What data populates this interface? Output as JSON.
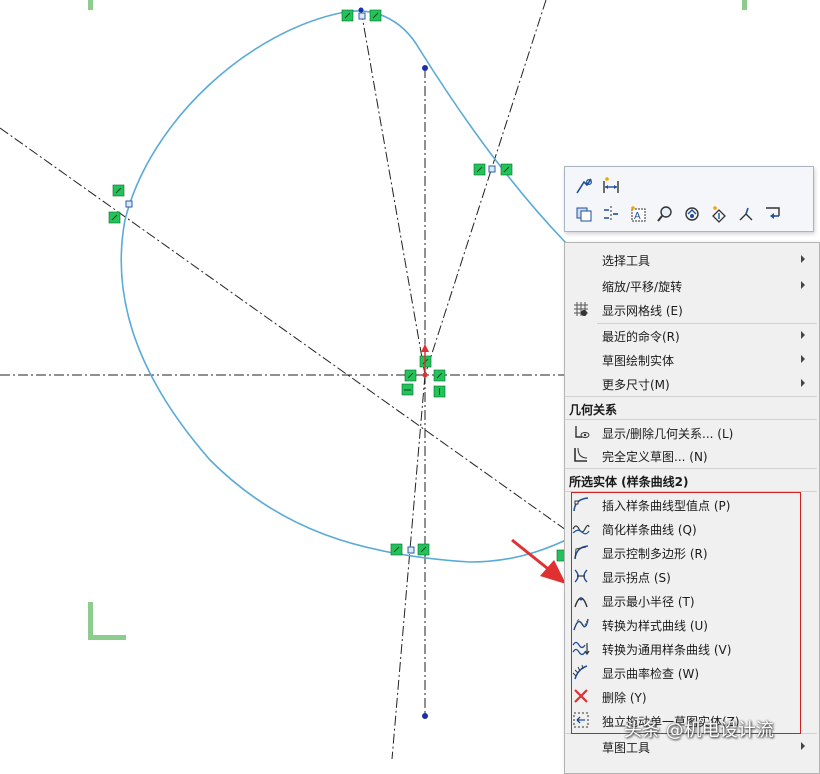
{
  "toolbar": {
    "row1": [
      "sketch-relation-icon",
      "smart-dimension-icon"
    ],
    "row2": [
      "select-other-icon",
      "mirror-icon",
      "text-icon",
      "zoom-to-selection-icon",
      "rotate-view-icon",
      "normal-to-icon",
      "sketch-face-icon",
      "exit-sketch-icon"
    ]
  },
  "menu": {
    "items": [
      {
        "label": "选择工具",
        "submenu": true,
        "icon": ""
      },
      {
        "label": "缩放/平移/旋转",
        "submenu": true,
        "icon": ""
      },
      {
        "label": "显示网格线 (E)",
        "submenu": false,
        "icon": "grid-icon"
      },
      {
        "label": "最近的命令(R)",
        "submenu": true,
        "icon": ""
      },
      {
        "label": "草图绘制实体",
        "submenu": true,
        "icon": ""
      },
      {
        "label": "更多尺寸(M)",
        "submenu": true,
        "icon": ""
      }
    ],
    "section_relations": "几何关系",
    "relation_items": [
      {
        "label": "显示/删除几何关系... (L)",
        "icon": "show-relations-icon"
      },
      {
        "label": "完全定义草图... (N)",
        "icon": "fully-define-icon"
      }
    ],
    "section_selected": "所选实体 (样条曲线2)",
    "spline_items": [
      {
        "label": "插入样条曲线型值点 (P)",
        "icon": "insert-spline-point-icon"
      },
      {
        "label": "简化样条曲线 (Q)",
        "icon": "simplify-spline-icon"
      },
      {
        "label": "显示控制多边形 (R)",
        "icon": "control-polygon-icon"
      },
      {
        "label": "显示拐点 (S)",
        "icon": "inflection-points-icon"
      },
      {
        "label": "显示最小半径 (T)",
        "icon": "minimum-radius-icon"
      },
      {
        "label": "转换为样式曲线 (U)",
        "icon": "style-spline-icon"
      },
      {
        "label": "转换为通用样条曲线 (V)",
        "icon": "general-spline-icon"
      },
      {
        "label": "显示曲率检查 (W)",
        "icon": "curvature-check-icon"
      },
      {
        "label": "删除 (Y)",
        "icon": "delete-icon"
      },
      {
        "label": "独立拖动单一草图实体(Z)",
        "icon": "drag-entity-icon"
      }
    ],
    "bottom_item": {
      "label": "草图工具",
      "submenu": true
    }
  },
  "watermark": "头条 @机电设计流",
  "colors": {
    "spline": "#5aaad8",
    "centerline": "#222222",
    "relation_marker": "#22c35a",
    "highlight": "#d02020",
    "arrow": "#e03030"
  }
}
